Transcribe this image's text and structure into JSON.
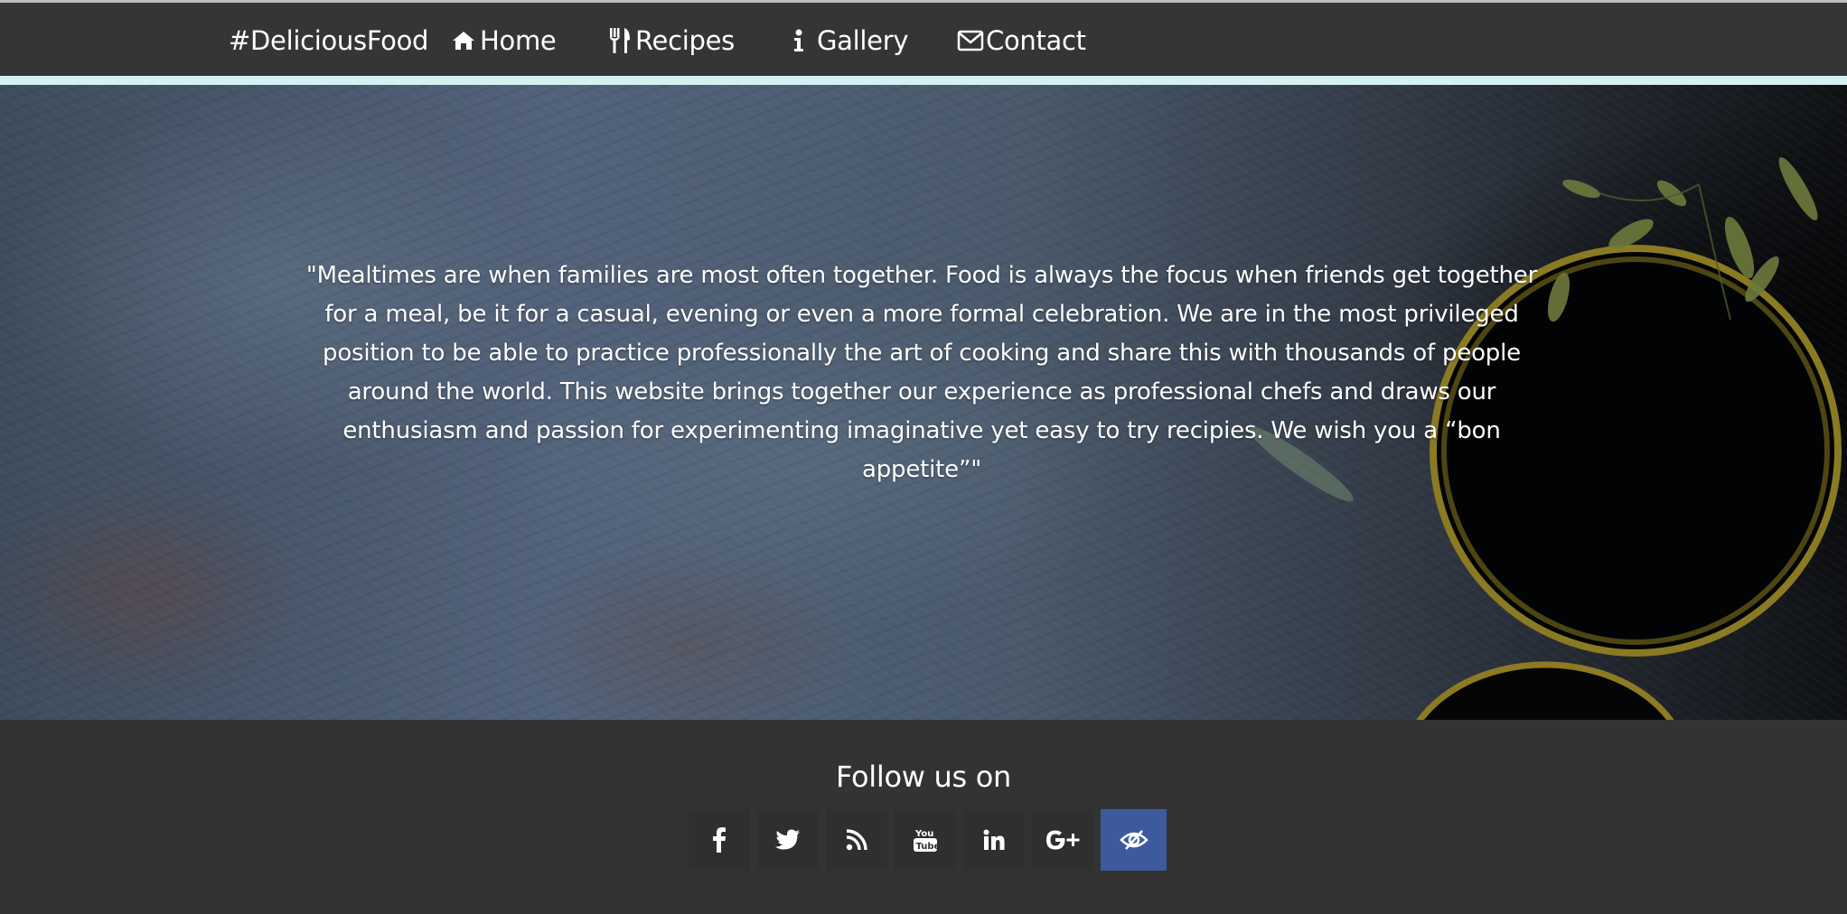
{
  "navbar": {
    "brand": "#DeliciousFood",
    "items": [
      {
        "label": "Home",
        "icon": "home-icon"
      },
      {
        "label": "Recipes",
        "icon": "cutlery-icon"
      },
      {
        "label": "Gallery",
        "icon": "info-icon"
      },
      {
        "label": "Contact",
        "icon": "envelope-icon"
      }
    ],
    "background": "#353535",
    "strip_color": "#d6f1f1"
  },
  "hero": {
    "quote": "\"Mealtimes are when families are most often together. Food is always the focus when friends get together for a meal, be it for a casual, evening or even a more formal celebration. We are in the most privileged position to be able to practice professionally the art of cooking and share this with thousands of people around the world. This website brings together our experience as professional chefs and draws our enthusiasm and passion for experimenting imaginative yet easy to try recipies. We wish you a “bon appetite”\""
  },
  "footer": {
    "heading": "Follow us on",
    "socials": [
      {
        "icon": "facebook-icon"
      },
      {
        "icon": "twitter-icon"
      },
      {
        "icon": "rss-icon"
      },
      {
        "icon": "youtube-icon"
      },
      {
        "icon": "linkedin-icon"
      },
      {
        "icon": "google-plus-icon"
      },
      {
        "icon": "eye-slash-icon",
        "active": true
      }
    ],
    "accent": "#3d5a9f",
    "background": "#333333"
  }
}
